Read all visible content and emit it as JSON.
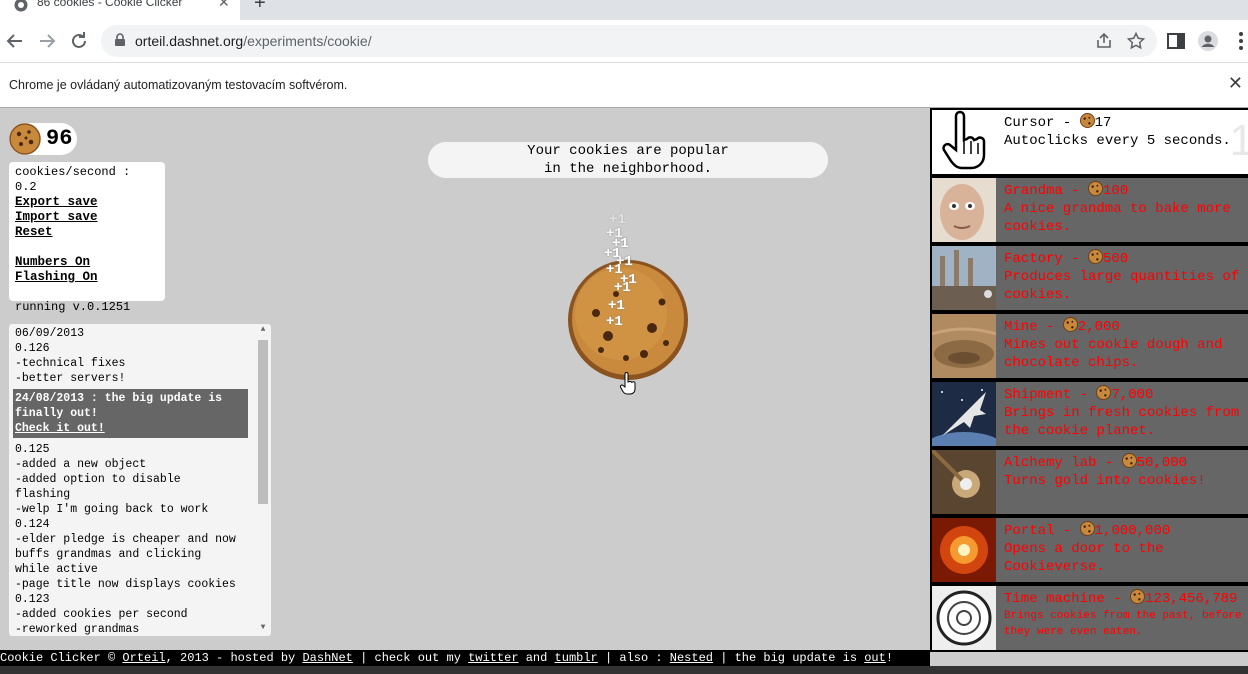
{
  "browser": {
    "tab_title": "86 cookies - Cookie Clicker",
    "url_host": "orteil.dashnet.org",
    "url_path": "/experiments/cookie/",
    "infobar_text": "Chrome je ovládaný automatizovaným testovacím softvérom."
  },
  "game": {
    "cookie_count": "96",
    "stats": {
      "cps": "cookies/second : 0.2",
      "export": "Export save",
      "import": "Import save",
      "reset": "Reset",
      "numbers": "Numbers On",
      "flashing": "Flashing On",
      "version": "running v.0.1251"
    },
    "changelog": {
      "lines_before": [
        "06/09/2013",
        "0.126",
        "-technical fixes",
        "-better servers!"
      ],
      "update_title": "24/08/2013 : the big update is finally out!",
      "update_link": "Check it out!",
      "lines_after": [
        "0.125",
        "-added a new object",
        "-added option to disable",
        "flashing",
        "-welp I'm going back to work",
        "0.124",
        "-elder pledge is cheaper and now",
        "buffs grandmas and clicking",
        "while active",
        "-page title now displays cookies",
        "0.123",
        "-added cookies per second",
        "-reworked grandmas"
      ]
    },
    "popularity": [
      "Your cookies are popular",
      "in the neighborhood."
    ],
    "plus_one": "+1",
    "store": [
      {
        "name": "Cursor",
        "price": "17",
        "desc": "Autoclicks every 5 seconds.",
        "owned": "1",
        "affordable": true
      },
      {
        "name": "Grandma",
        "price": "100",
        "desc": "A nice grandma to bake more cookies.",
        "affordable": false
      },
      {
        "name": "Factory",
        "price": "500",
        "desc": "Produces large quantities of cookies.",
        "affordable": false
      },
      {
        "name": "Mine",
        "price": "2,000",
        "desc": "Mines out cookie dough and chocolate chips.",
        "affordable": false
      },
      {
        "name": "Shipment",
        "price": "7,000",
        "desc": "Brings in fresh cookies from the cookie planet.",
        "affordable": false
      },
      {
        "name": "Alchemy lab",
        "price": "50,000",
        "desc": "Turns gold into cookies!",
        "affordable": false
      },
      {
        "name": "Portal",
        "price": "1,000,000",
        "desc": "Opens a door to the Cookieverse.",
        "affordable": false
      },
      {
        "name": "Time machine",
        "price": "123,456,789",
        "desc": "Brings cookies from the past, before they were even eaten.",
        "affordable": false
      }
    ],
    "footer": {
      "prefix": "Cookie Clicker © ",
      "orteil": "Orteil",
      "mid1": ", 2013 - hosted by ",
      "dashnet": "DashNet",
      "mid2": " | check out my ",
      "twitter": "twitter",
      "and": " and ",
      "tumblr": "tumblr",
      "mid3": " | also : ",
      "nested": "Nested",
      "mid4": " | the big update is ",
      "out": "out",
      "end": "!"
    }
  }
}
